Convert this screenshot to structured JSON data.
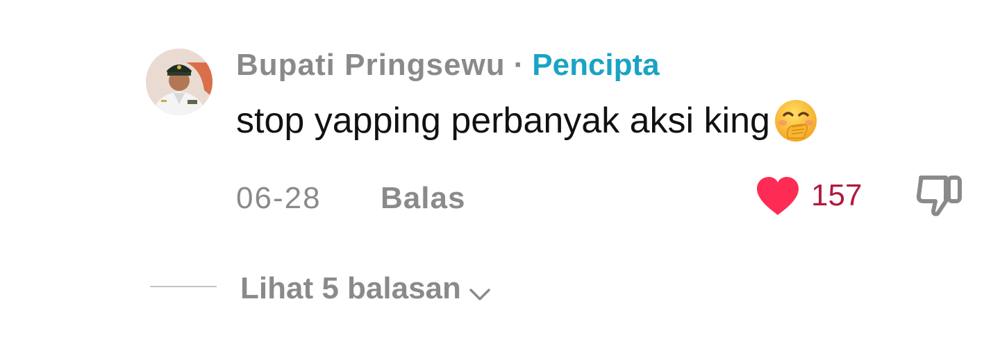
{
  "comment": {
    "username": "Bupati Pringsewu",
    "separator": "·",
    "creator_badge": "Pencipta",
    "text": "stop yapping perbanyak aksi king",
    "emoji": "hand-over-mouth-face",
    "date": "06-28",
    "reply_label": "Balas",
    "like_count": "157",
    "liked": true
  },
  "replies": {
    "view_label": "Lihat 5 balasan"
  },
  "colors": {
    "username": "#8a8a8a",
    "creator_badge": "#1aa3c4",
    "like_heart": "#fe2c55",
    "like_count": "#b01a3c",
    "meta_text": "#8a8a8a"
  },
  "icons": {
    "like": "heart-icon",
    "dislike": "thumbs-down-icon",
    "expand": "chevron-down-icon"
  }
}
